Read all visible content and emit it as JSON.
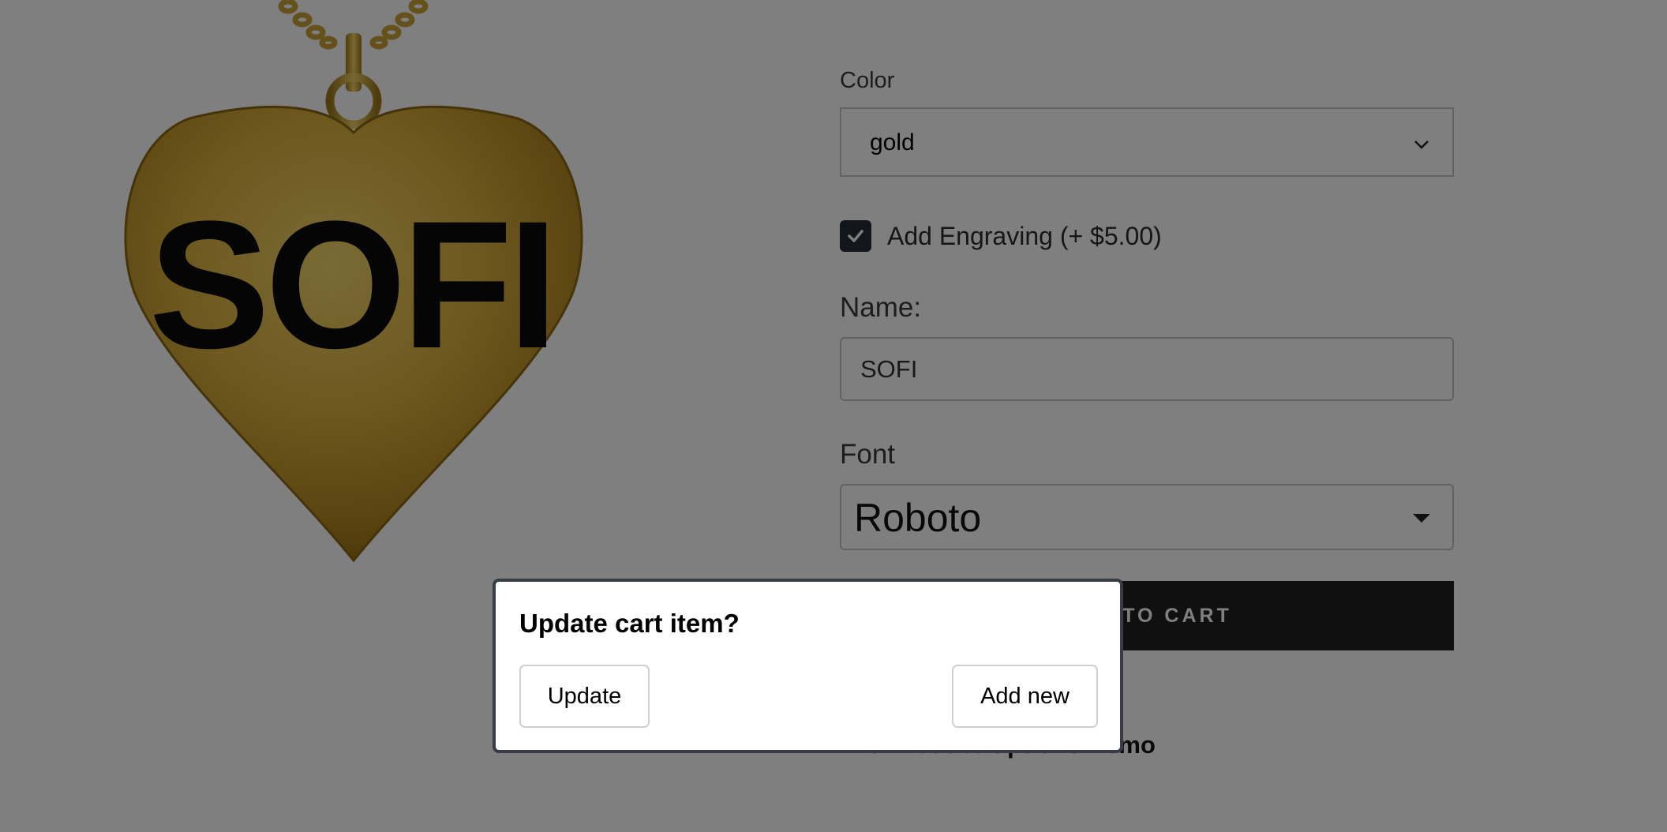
{
  "product_image": {
    "engraved_text": "SOFI",
    "alt": "gold heart necklace"
  },
  "form": {
    "color_label": "Color",
    "color_value": "gold",
    "engraving_label": "Add Engraving (+ $5.00)",
    "engraving_checked": true,
    "name_label": "Name:",
    "name_value": "SOFI",
    "font_label": "Font",
    "font_value": "Roboto",
    "add_to_cart_label": "ADD TO CART"
  },
  "footer": {
    "title": "LNC Product Options Demo"
  },
  "modal": {
    "title": "Update cart item?",
    "update_label": "Update",
    "add_new_label": "Add new"
  },
  "colors": {
    "accent_dark": "#202020",
    "checkbox": "#242a38",
    "gold": "#b8952a"
  }
}
